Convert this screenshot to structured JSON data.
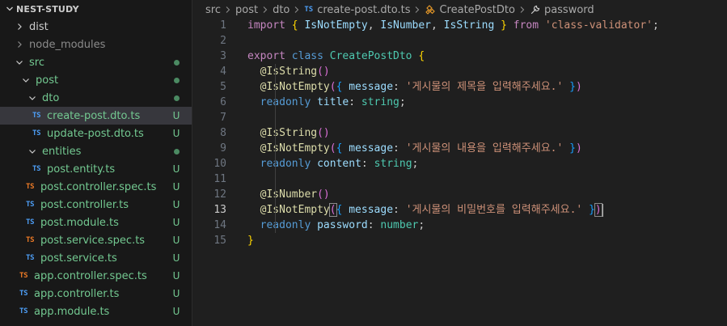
{
  "explorer": {
    "project_title": "NEST-STUDY",
    "items": [
      {
        "label": "dist",
        "type": "folder",
        "depth": 1,
        "expanded": false
      },
      {
        "label": "node_modules",
        "type": "folder",
        "depth": 1,
        "expanded": false,
        "dim": true
      },
      {
        "label": "src",
        "type": "folder",
        "depth": 1,
        "expanded": true,
        "status": "dot"
      },
      {
        "label": "post",
        "type": "folder",
        "depth": 2,
        "expanded": true,
        "status": "dot"
      },
      {
        "label": "dto",
        "type": "folder",
        "depth": 3,
        "expanded": true,
        "status": "dot"
      },
      {
        "label": "create-post.dto.ts",
        "type": "file",
        "badge": "TS",
        "badge_color": "#4d9ef6",
        "depth": 4,
        "status": "U",
        "selected": true
      },
      {
        "label": "update-post.dto.ts",
        "type": "file",
        "badge": "TS",
        "badge_color": "#4d9ef6",
        "depth": 4,
        "status": "U"
      },
      {
        "label": "entities",
        "type": "folder",
        "depth": 3,
        "expanded": true,
        "status": "dot"
      },
      {
        "label": "post.entity.ts",
        "type": "file",
        "badge": "TS",
        "badge_color": "#4d9ef6",
        "depth": 4,
        "status": "U"
      },
      {
        "label": "post.controller.spec.ts",
        "type": "file",
        "badge": "TS",
        "badge_color": "#ec7a26",
        "depth": 3,
        "status": "U"
      },
      {
        "label": "post.controller.ts",
        "type": "file",
        "badge": "TS",
        "badge_color": "#4d9ef6",
        "depth": 3,
        "status": "U"
      },
      {
        "label": "post.module.ts",
        "type": "file",
        "badge": "TS",
        "badge_color": "#4d9ef6",
        "depth": 3,
        "status": "U"
      },
      {
        "label": "post.service.spec.ts",
        "type": "file",
        "badge": "TS",
        "badge_color": "#ec7a26",
        "depth": 3,
        "status": "U"
      },
      {
        "label": "post.service.ts",
        "type": "file",
        "badge": "TS",
        "badge_color": "#4d9ef6",
        "depth": 3,
        "status": "U"
      },
      {
        "label": "app.controller.spec.ts",
        "type": "file",
        "badge": "TS",
        "badge_color": "#ec7a26",
        "depth": 2,
        "status": "U"
      },
      {
        "label": "app.controller.ts",
        "type": "file",
        "badge": "TS",
        "badge_color": "#4d9ef6",
        "depth": 2,
        "status": "U"
      },
      {
        "label": "app.module.ts",
        "type": "file",
        "badge": "TS",
        "badge_color": "#4d9ef6",
        "depth": 2,
        "status": "U"
      }
    ]
  },
  "breadcrumb": {
    "segments": [
      "src",
      "post",
      "dto"
    ],
    "file_badge": "TS",
    "file": "create-post.dto.ts",
    "class_symbol": "CreatePostDto",
    "property_symbol": "password"
  },
  "editor": {
    "active_line": 13,
    "lines": [
      {
        "n": "1",
        "t": "import { IsNotEmpty, IsNumber, IsString } from 'class-validator';"
      },
      {
        "n": "2",
        "t": ""
      },
      {
        "n": "3",
        "t": "export class CreatePostDto {"
      },
      {
        "n": "4",
        "t": "  @IsString()"
      },
      {
        "n": "5",
        "t": "  @IsNotEmpty({ message: '게시물의 제목을 입력해주세요.' })"
      },
      {
        "n": "6",
        "t": "  readonly title: string;"
      },
      {
        "n": "7",
        "t": ""
      },
      {
        "n": "8",
        "t": "  @IsString()"
      },
      {
        "n": "9",
        "t": "  @IsNotEmpty({ message: '게시물의 내용을 입력해주세요.' })"
      },
      {
        "n": "10",
        "t": "  readonly content: string;"
      },
      {
        "n": "11",
        "t": ""
      },
      {
        "n": "12",
        "t": "  @IsNumber()"
      },
      {
        "n": "13",
        "t": "  @IsNotEmpty({ message: '게시물의 비밀번호를 입력해주세요.' })"
      },
      {
        "n": "14",
        "t": "  readonly password: number;"
      },
      {
        "n": "15",
        "t": "}"
      }
    ]
  },
  "colors": {
    "keyword": "#c586c0",
    "storage": "#569cd6",
    "class": "#4ec9b0",
    "variable": "#9cdcfe",
    "function": "#dcdcaa",
    "string": "#ce9178",
    "git_untracked": "#73c991"
  },
  "icons": {
    "chevron_right": "chevron-right-icon",
    "chevron_down": "chevron-down-icon",
    "class_symbol": "class-symbol-icon",
    "property_symbol": "wrench-icon"
  }
}
